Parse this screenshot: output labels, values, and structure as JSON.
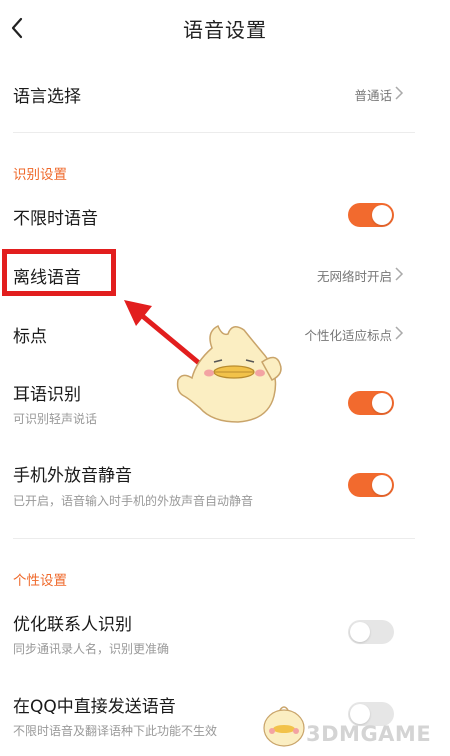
{
  "header": {
    "title": "语音设置"
  },
  "rows": {
    "language": {
      "label": "语言选择",
      "value": "普通话"
    },
    "unlimited": {
      "label": "不限时语音",
      "on": true
    },
    "offline": {
      "label": "离线语音",
      "value": "无网络时开启"
    },
    "punctuation": {
      "label": "标点",
      "value": "个性化适应标点"
    },
    "whisper": {
      "label": "耳语识别",
      "sub": "可识别轻声说话",
      "on": true
    },
    "mute": {
      "label": "手机外放音静音",
      "sub": "已开启，语音输入时手机的外放声音自动静音",
      "on": true
    },
    "contacts": {
      "label": "优化联系人识别",
      "sub": "同步通讯录人名，识别更准确",
      "on": false
    },
    "qq": {
      "label": "在QQ中直接发送语音",
      "sub": "不限时语音及翻译语种下此功能不生效",
      "on": false
    }
  },
  "sections": {
    "recognition": "识别设置",
    "personal": "个性设置"
  },
  "watermark": {
    "text": "3DMGAME"
  },
  "colors": {
    "accent": "#f26a2e",
    "section": "#ef6a2c",
    "highlight": "#e21e1e",
    "toggle_off": "#e6e6e6"
  },
  "icons": [
    "back-arrow-icon",
    "chevron-right-icon",
    "chick-mascot-illustration",
    "red-arrow-annotation"
  ]
}
